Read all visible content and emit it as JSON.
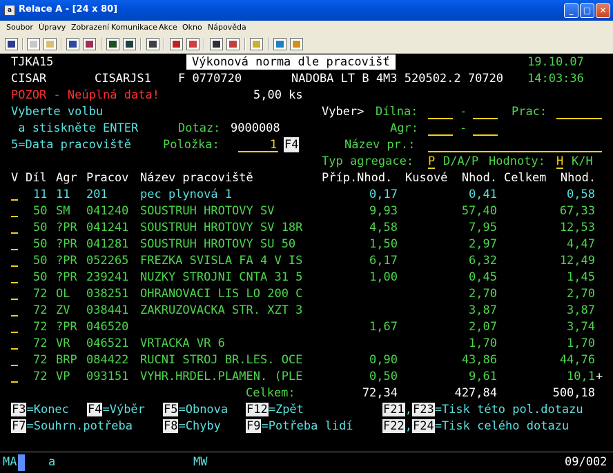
{
  "window": {
    "title": "Relace A - [24 x 80]",
    "icon_text": "a"
  },
  "menu": [
    "Soubor",
    "Úpravy",
    "Zobrazení",
    "Komunikace",
    "Akce",
    "Okno",
    "Nápověda"
  ],
  "toolbar_icons": [
    "print-icon",
    "copy-icon",
    "paste-icon",
    "send-icon",
    "receive-icon",
    "display-icon",
    "keyboard-icon",
    "macro-icon",
    "record-icon",
    "stop-icon",
    "play-icon",
    "pause-icon",
    "clipboard-icon",
    "globe-icon",
    "key-icon"
  ],
  "header": {
    "program": "TJKA15",
    "screen_title": "Výkonová norma dle pracovišť",
    "date": "19.10.07",
    "user": "CISAR",
    "device": "CISARJS1",
    "f_code": "F 0770720",
    "item_desc": "NADOBA LT B 4M3 520502.2 70720",
    "time": "14:03:36",
    "warning": "POZOR - Neúplná data!",
    "quantity": "5,00 ks"
  },
  "prompts": {
    "choose": "Vyberte volbu",
    "press_enter": " a stiskněte ENTER",
    "data_option": "5=Data pracoviště",
    "query_label": "Dotaz:",
    "query_value": "9000008",
    "item_label": "Položka:",
    "item_value": "1",
    "f4_tag": "F4",
    "select_label": "Vyber>",
    "dilna_label": "Dílna:",
    "dash": "-",
    "prac_label": "Prac:",
    "agr_label": "Agr:",
    "name_label": "Název pr.:",
    "agg_type_label": "Typ agregace:",
    "agg_type_value": "P",
    "agg_type_opts": "D/A/P",
    "values_label": "Hodnoty:",
    "values_value": "H",
    "values_opts": "K/H"
  },
  "columns": {
    "v": "V",
    "dil": "Díl",
    "agr": "Agr",
    "pracov": "Pracov",
    "nazev": "Název pracoviště",
    "prip": "Příp.Nhod.",
    "kusove": "Kusové  Nhod.",
    "celkem": "Celkem  Nhod."
  },
  "rows": [
    {
      "dil": "11",
      "agr": "11",
      "pracov": "201",
      "nazev": "pec plynová 1",
      "prip": "0,17",
      "kus": "0,41",
      "cel": "0,58",
      "cls": "c"
    },
    {
      "dil": "50",
      "agr": "SM",
      "pracov": "041240",
      "nazev": "SOUSTRUH HROTOVY SV",
      "prip": "9,93",
      "kus": "57,40",
      "cel": "67,33",
      "cls": "g"
    },
    {
      "dil": "50",
      "agr": "?PR",
      "pracov": "041241",
      "nazev": "SOUSTRUH HROTOVY SV 18R",
      "prip": "4,58",
      "kus": "7,95",
      "cel": "12,53",
      "cls": "g"
    },
    {
      "dil": "50",
      "agr": "?PR",
      "pracov": "041281",
      "nazev": "SOUSTRUH HROTOVY SU 50",
      "prip": "1,50",
      "kus": "2,97",
      "cel": "4,47",
      "cls": "g"
    },
    {
      "dil": "50",
      "agr": "?PR",
      "pracov": "052265",
      "nazev": "FREZKA SVISLA FA 4 V IS",
      "prip": "6,17",
      "kus": "6,32",
      "cel": "12,49",
      "cls": "g"
    },
    {
      "dil": "50",
      "agr": "?PR",
      "pracov": "239241",
      "nazev": "NUZKY STROJNI CNTA 31 5",
      "prip": "1,00",
      "kus": "0,45",
      "cel": "1,45",
      "cls": "g"
    },
    {
      "dil": "72",
      "agr": "OL",
      "pracov": "038251",
      "nazev": "OHRANOVACI LIS LO 200 C",
      "prip": "",
      "kus": "2,70",
      "cel": "2,70",
      "cls": "g"
    },
    {
      "dil": "72",
      "agr": "ZV",
      "pracov": "038441",
      "nazev": "ZAKRUZOVACKA STR. XZT 3",
      "prip": "",
      "kus": "3,87",
      "cel": "3,87",
      "cls": "g"
    },
    {
      "dil": "72",
      "agr": "?PR",
      "pracov": "046520",
      "nazev": "",
      "prip": "1,67",
      "kus": "2,07",
      "cel": "3,74",
      "cls": "g"
    },
    {
      "dil": "72",
      "agr": "VR",
      "pracov": "046521",
      "nazev": "VRTACKA VR 6",
      "prip": "",
      "kus": "1,70",
      "cel": "1,70",
      "cls": "g"
    },
    {
      "dil": "72",
      "agr": "BRP",
      "pracov": "084422",
      "nazev": "RUCNI STROJ BR.LES. OCE",
      "prip": "0,90",
      "kus": "43,86",
      "cel": "44,76",
      "cls": "g"
    },
    {
      "dil": "72",
      "agr": "VP",
      "pracov": "093151",
      "nazev": "VYHR.HRDEL.PLAMEN. (PLE",
      "prip": "0,50",
      "kus": "9,61",
      "cel": "10,1",
      "cls": "g"
    }
  ],
  "more_indicator": "+",
  "totals": {
    "label": "Celkem:",
    "prip": "72,34",
    "kus": "427,84",
    "cel": "500,18"
  },
  "fkeys": {
    "f3": {
      "key": "F3",
      "label": "=Konec"
    },
    "f4": {
      "key": "F4",
      "label": "=Výběr"
    },
    "f5": {
      "key": "F5",
      "label": "=Obnova"
    },
    "f12": {
      "key": "F12",
      "label": "=Zpět"
    },
    "f21": {
      "key": "F21",
      "sep": ",",
      "key2": "F23",
      "label": "=Tisk této pol.dotazu"
    },
    "f7": {
      "key": "F7",
      "label": "=Souhrn.potřeba"
    },
    "f8": {
      "key": "F8",
      "label": "=Chyby"
    },
    "f9": {
      "key": "F9",
      "label": "=Potřeba lidí"
    },
    "f22": {
      "key": "F22",
      "sep": ",",
      "key2": "F24",
      "label": "=Tisk celého dotazu"
    }
  },
  "status": {
    "mode": "MA",
    "session": "a",
    "mw": "MW",
    "position": "09/002"
  }
}
